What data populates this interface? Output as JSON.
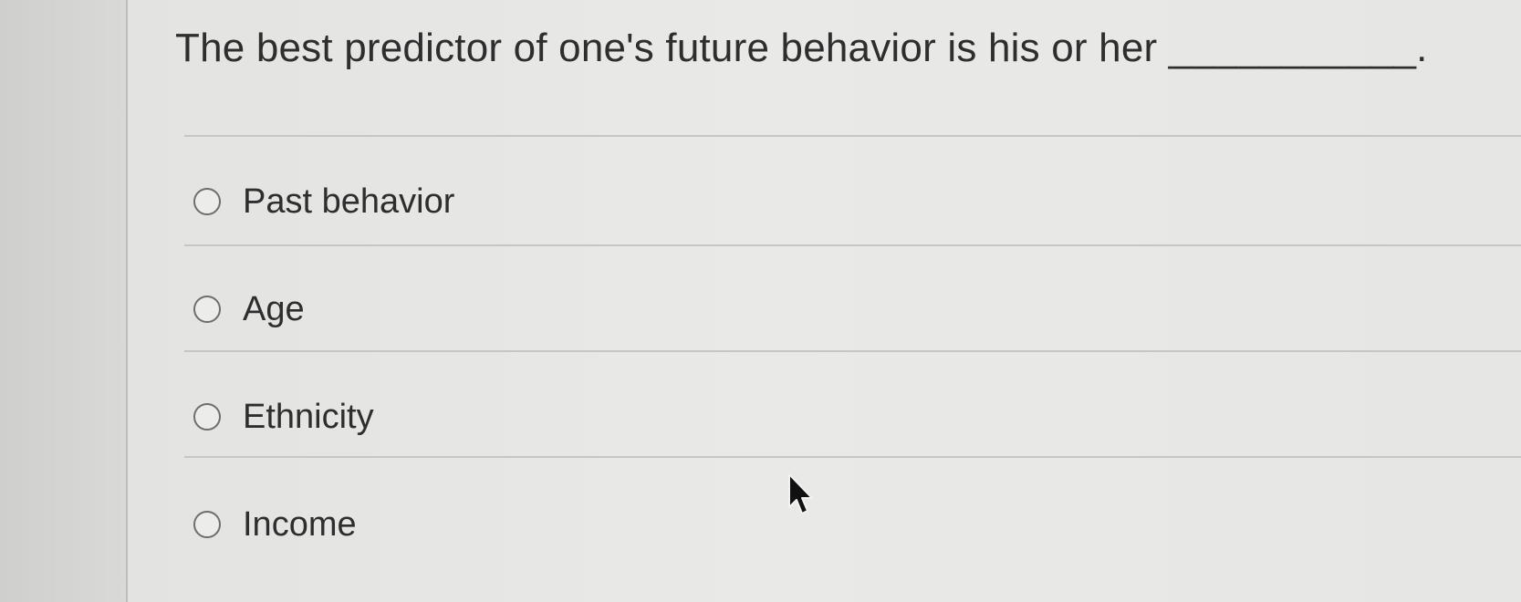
{
  "question": {
    "text": "The best predictor of one's future behavior is his or her ___________."
  },
  "options": [
    {
      "label": "Past behavior",
      "selected": false
    },
    {
      "label": "Age",
      "selected": false
    },
    {
      "label": "Ethnicity",
      "selected": false
    },
    {
      "label": "Income",
      "selected": false
    }
  ],
  "cursor": {
    "icon": "mouse-pointer-icon"
  },
  "colors": {
    "background": "#e6e6e4",
    "text": "#2e2e2e",
    "divider": "#c6c6c4",
    "radio_border": "#6e6e6e"
  }
}
